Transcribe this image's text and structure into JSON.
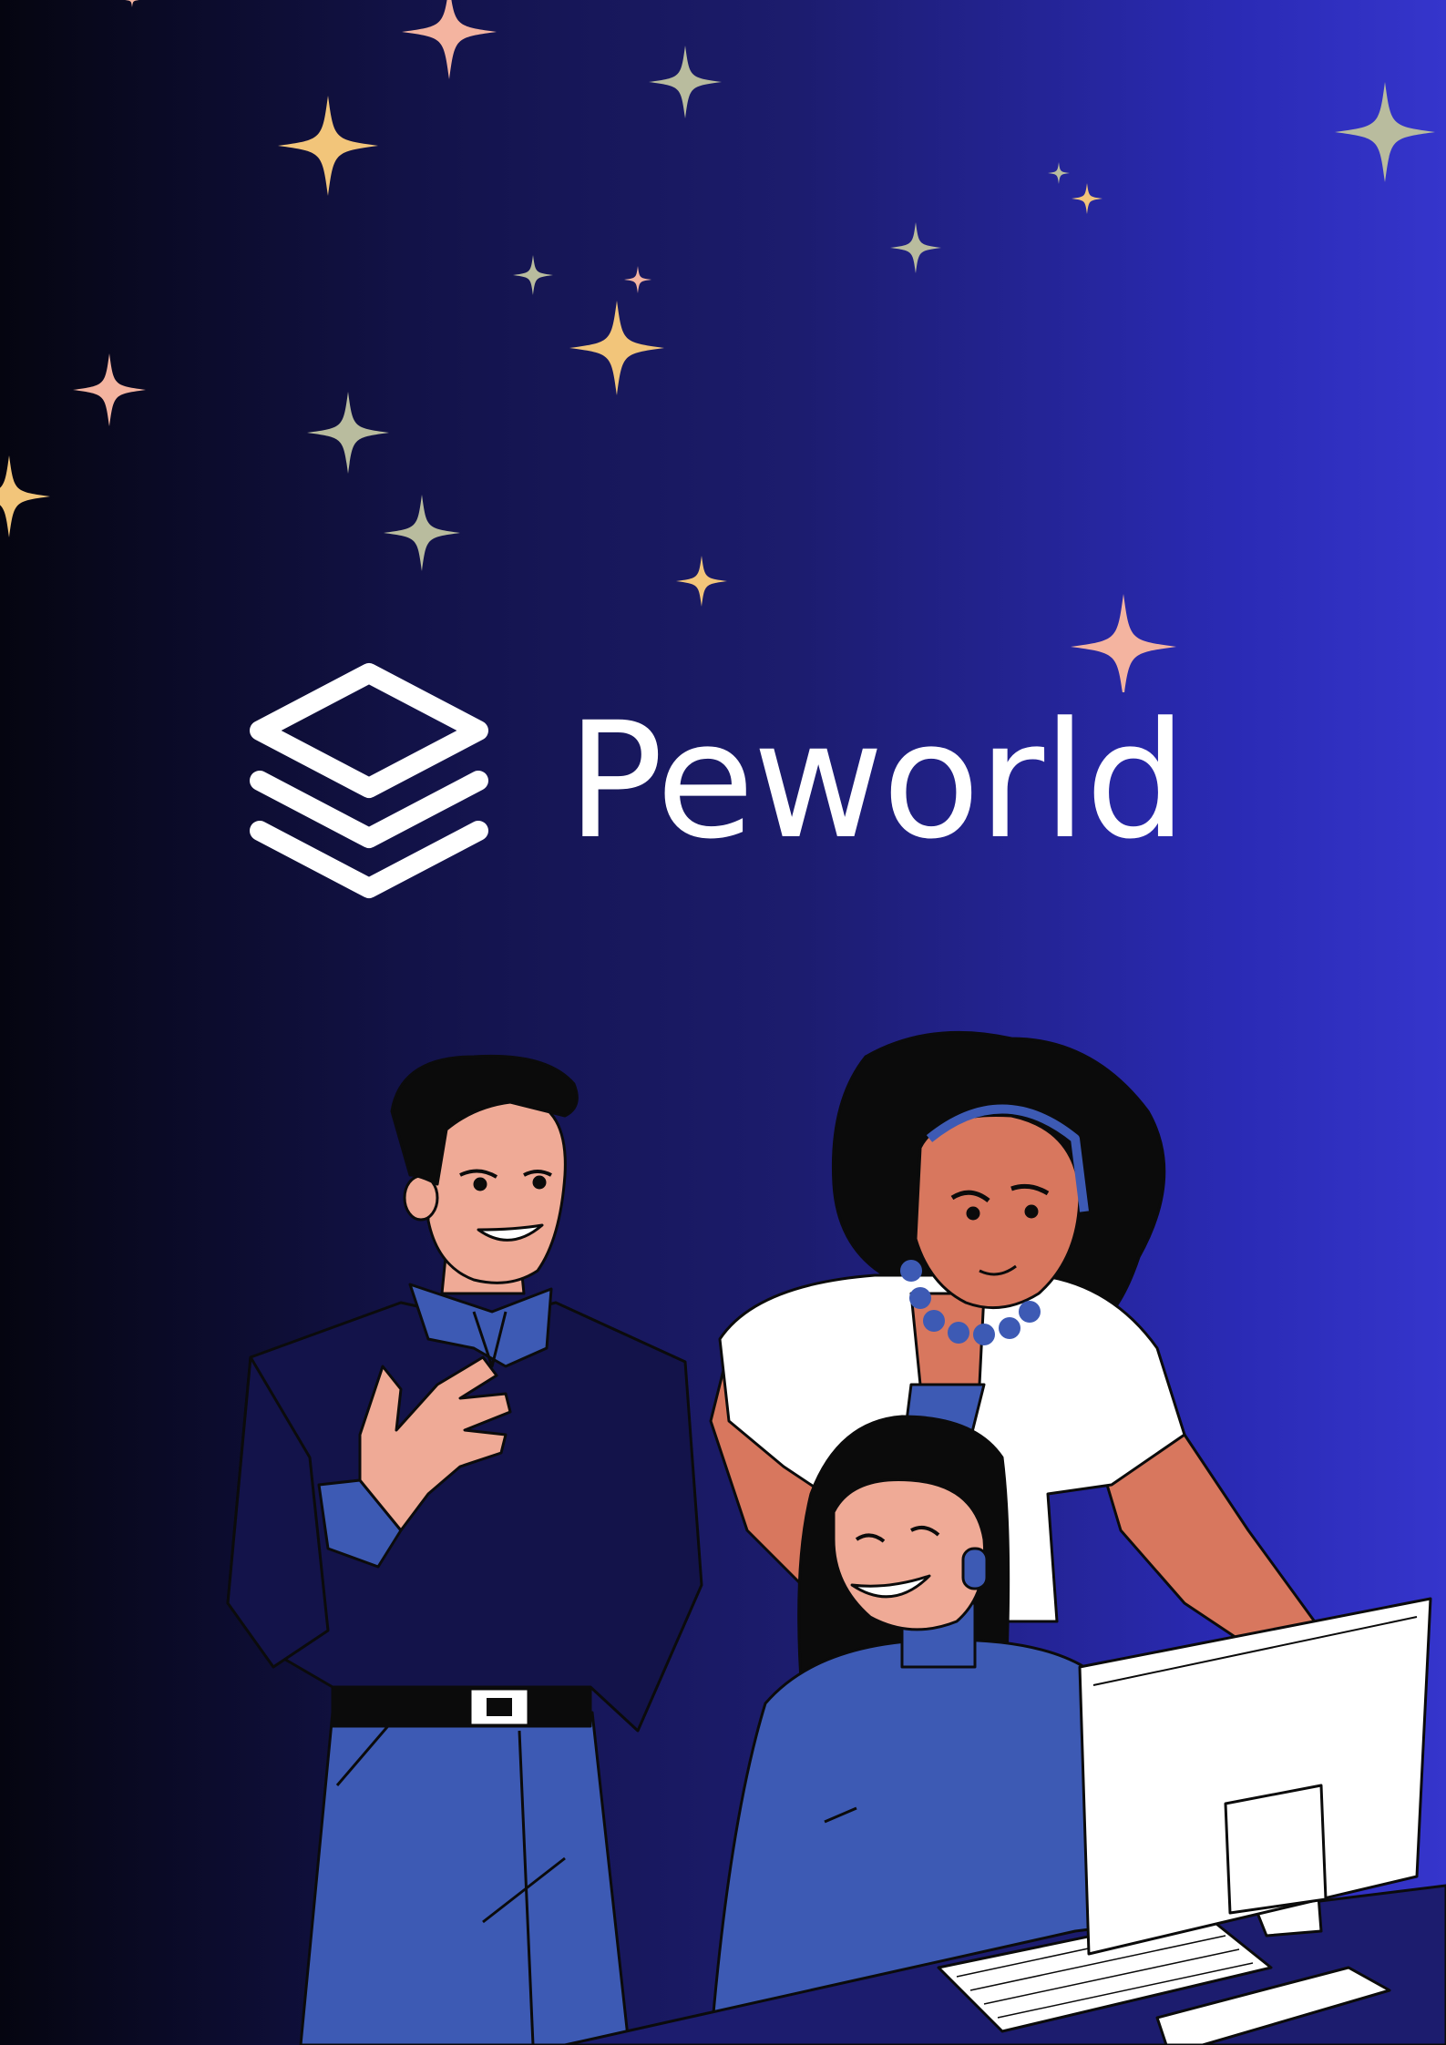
{
  "brand": {
    "name": "Peworld",
    "logo_icon": "stacked-layers-icon"
  },
  "colors": {
    "background_left": "#050510",
    "background_right": "#3535cc",
    "star_gold": "#f2c57a",
    "star_peach": "#f4b4a0",
    "star_sage": "#b9bc9e",
    "text": "#ffffff",
    "skin_light": "#efaa96",
    "skin_tan": "#d8775e",
    "navy_shirt": "#13134a",
    "blue_cloth": "#3d5ab4",
    "white": "#ffffff",
    "hair": "#0b0b0b"
  },
  "illustration": {
    "description_icon": "three-coworkers-at-computer-illustration"
  }
}
